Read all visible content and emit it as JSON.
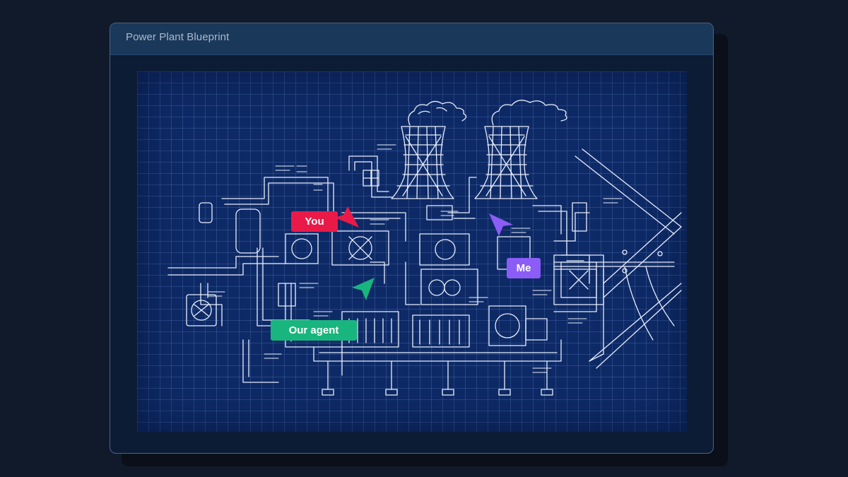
{
  "window": {
    "title": "Power Plant Blueprint"
  },
  "cursors": [
    {
      "label": "You",
      "color": "#ea1a48"
    },
    {
      "label": "Me",
      "color": "#8b5cf6"
    },
    {
      "label": "Our agent",
      "color": "#19b57e"
    }
  ],
  "colors": {
    "background": "#111a2b",
    "titlebar": "#1a385a",
    "blueprint": "#0e2a66",
    "line": "#e8eefc"
  },
  "icons": [
    "cursor-arrow-icon"
  ]
}
